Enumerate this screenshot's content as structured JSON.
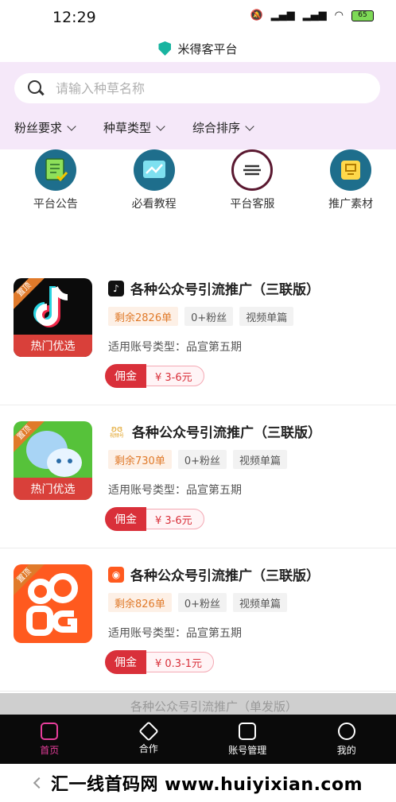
{
  "status_bar": {
    "time": "12:29",
    "battery": "65"
  },
  "header": {
    "title": "米得客平台"
  },
  "search": {
    "placeholder": "请输入种草名称"
  },
  "filters": [
    {
      "label": "粉丝要求"
    },
    {
      "label": "种草类型"
    },
    {
      "label": "综合排序"
    }
  ],
  "quick_menu": [
    {
      "label": "平台公告",
      "icon": "notebook-icon",
      "color": "#1e6e8c"
    },
    {
      "label": "必看教程",
      "icon": "chart-icon",
      "color": "#1e6e8c"
    },
    {
      "label": "平台客服",
      "icon": "chat-icon",
      "color": "#ffffff"
    },
    {
      "label": "推广素材",
      "icon": "folder-icon",
      "color": "#1e6e8c"
    }
  ],
  "cards": [
    {
      "platform": "tiktok-icon",
      "thumb_ribbon": "热门优选",
      "thumb_corner": "置顶",
      "title": "各种公众号引流推广（三联版）",
      "tags": [
        "剩余2826单",
        "0+粉丝",
        "视频单篇"
      ],
      "account_type": "适用账号类型：品宣第五期",
      "commission_label": "佣金",
      "commission_value": "¥ 3-6元"
    },
    {
      "platform": "wechat-channels-icon",
      "platform_text": "视频号",
      "thumb_ribbon": "热门优选",
      "thumb_corner": "置顶",
      "title": "各种公众号引流推广（三联版）",
      "tags": [
        "剩余730单",
        "0+粉丝",
        "视频单篇"
      ],
      "account_type": "适用账号类型：品宣第五期",
      "commission_label": "佣金",
      "commission_value": "¥ 3-6元"
    },
    {
      "platform": "kuaishou-icon",
      "thumb_ribbon": "",
      "thumb_corner": "置顶",
      "title": "各种公众号引流推广（三联版）",
      "tags": [
        "剩余826单",
        "0+粉丝",
        "视频单篇"
      ],
      "account_type": "适用账号类型：品宣第五期",
      "commission_label": "佣金",
      "commission_value": "¥ 0.3-1元"
    }
  ],
  "partial_card_title": "各种公众号引流推广（单发版）",
  "tabs": [
    {
      "label": "首页",
      "active": true,
      "icon": "home-icon"
    },
    {
      "label": "合作",
      "active": false,
      "icon": "cooperate-icon"
    },
    {
      "label": "账号管理",
      "active": false,
      "icon": "account-icon"
    },
    {
      "label": "我的",
      "active": false,
      "icon": "profile-icon"
    }
  ],
  "watermark": "汇一线首码网 www.huiyixian.com"
}
